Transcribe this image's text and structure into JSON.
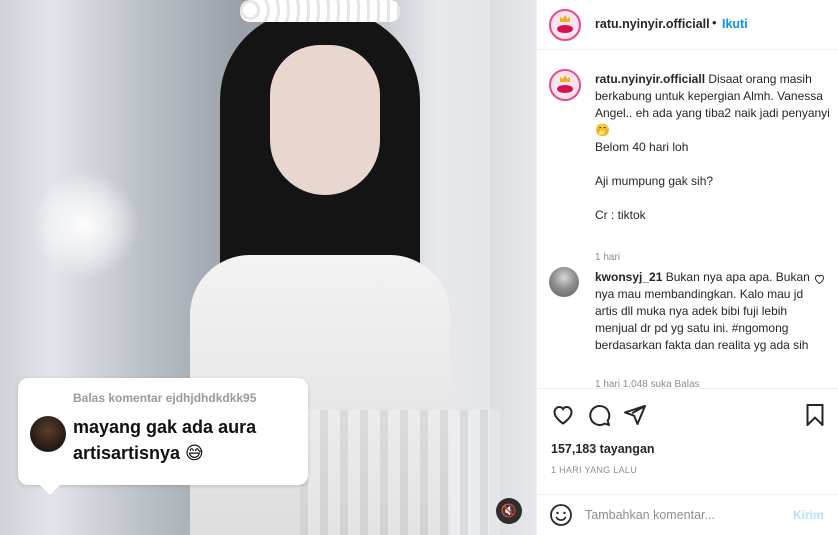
{
  "media": {
    "reply_header": "Balas komentar ejdhjdhdkdkk95",
    "reply_text": "mayang gak ada aura artisartisnya 😅",
    "mute_icon": "🔇"
  },
  "header": {
    "username": "ratu.nyinyir.officiall",
    "separator": "•",
    "follow_label": "Ikuti"
  },
  "caption": {
    "username": "ratu.nyinyir.officiall",
    "line1": "Disaat orang masih berkabung untuk kepergian Almh. Vanessa Angel.. eh ada yang tiba2 naik jadi penyanyi 🤭",
    "line2": "Belom 40 hari loh",
    "line3": "Aji mumpung gak sih?",
    "line4": "Cr : tiktok",
    "time": "1 hari"
  },
  "comment": {
    "username": "kwonsyj_21",
    "text": "Bukan nya apa apa. Bukan nya mau membandingkan. Kalo mau jd artis dll muka nya adek bibi fuji lebih menjual dr pd yg satu ini. #ngomong berdasarkan fakta dan realita yg ada sih",
    "meta": "1 hari   1.048 suka   Balas"
  },
  "stats": {
    "views": "157,183 tayangan",
    "date": "1 HARI YANG LALU"
  },
  "add_comment": {
    "placeholder": "Tambahkan komentar...",
    "send_label": "Kirim"
  },
  "colors": {
    "accent": "#0095f6",
    "send_disabled": "#b2dffc",
    "meta_gray": "#8e8e8e"
  }
}
